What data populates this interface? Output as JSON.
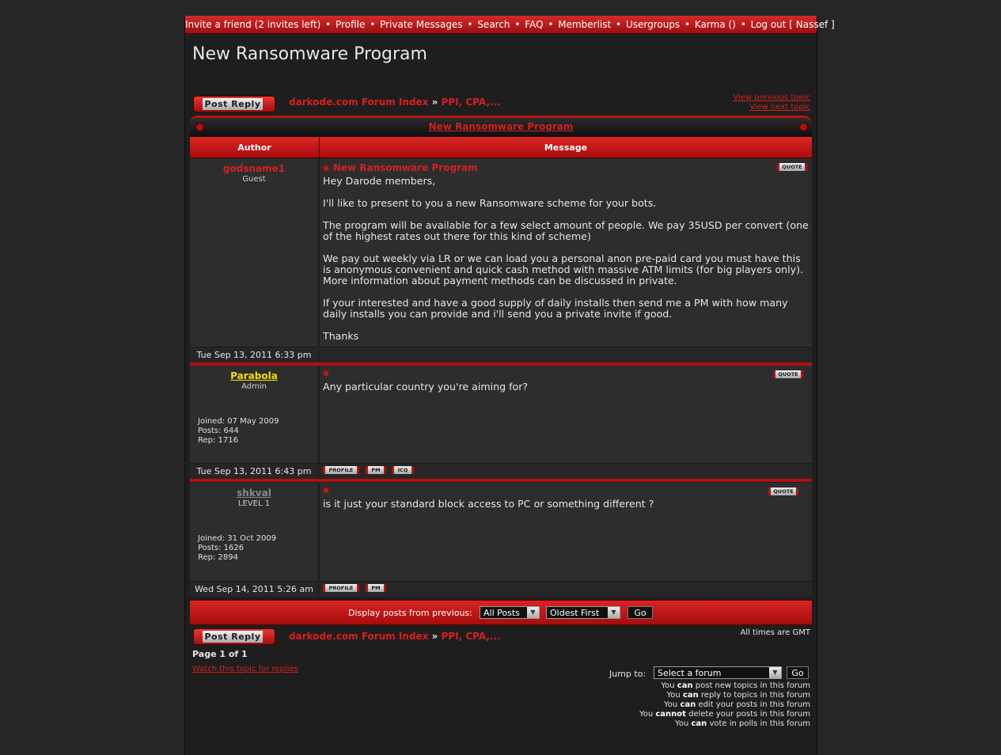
{
  "nav": {
    "items": [
      "Invite a friend (2 invites left)",
      "Profile",
      "Private Messages",
      "Search",
      "FAQ",
      "Memberlist",
      "Usergroups",
      "Karma ()",
      "Log out [ Nassef ]"
    ]
  },
  "page_title": "New Ransomware Program",
  "post_reply_label": "Post Reply",
  "breadcrumb": {
    "index": "darkode.com Forum Index",
    "arrow": "»",
    "forum": "PPI, CPA,..."
  },
  "prev_topic": "View previous topic",
  "next_topic": "View next topic",
  "topic_title": "New Ransomware Program",
  "columns": {
    "author": "Author",
    "message": "Message"
  },
  "quote_label": "QUOTE",
  "posts": [
    {
      "username": "godsname1",
      "rank": "Guest",
      "title": "New Ransomware Program",
      "body": [
        "Hey Darode members,",
        "I'll like to present to you a new Ransomware scheme for your bots.",
        "The program will be available for a few select amount of people. We pay 35USD per convert (one of the highest rates out there for this kind of scheme)",
        "We pay out weekly via LR or we can load you a personal anon pre-paid card you must have this is anonymous convenient and quick cash method with massive ATM limits (for big players only). More information about payment methods can be discussed in private.",
        "If your interested and have a good supply of daily installs then send me a PM with how many daily installs you can provide and i'll send you a private invite if good.",
        "Thanks"
      ],
      "date": "Tue Sep 13, 2011 6:33 pm"
    },
    {
      "username": "Parabola",
      "rank": "Admin",
      "joined": "Joined: 07 May 2009",
      "posts_count": "Posts: 644",
      "rep": "Rep: 1716",
      "body": [
        "Any particular country you're aiming for?"
      ],
      "date": "Tue Sep 13, 2011 6:43 pm",
      "buttons": [
        "PROFILE",
        "PM",
        "ICQ"
      ]
    },
    {
      "username": "shkval",
      "rank": "LEVEL 1",
      "joined": "Joined: 31 Oct 2009",
      "posts_count": "Posts: 1626",
      "rep": "Rep: 2894",
      "body": [
        "is it just your standard block access to PC or something different ?"
      ],
      "date": "Wed Sep 14, 2011 5:26 am",
      "buttons": [
        "PROFILE",
        "PM"
      ]
    }
  ],
  "display": {
    "label": "Display posts from previous:",
    "range_value": "All Posts",
    "order_value": "Oldest First",
    "go_label": "Go"
  },
  "footer": {
    "all_times": "All times are GMT",
    "page_of": "Page 1 of 1",
    "watch": "Watch this topic for replies",
    "jump_label": "Jump to:",
    "jump_value": "Select a forum",
    "go_label": "Go",
    "permissions": [
      [
        "You ",
        "can",
        " post new topics in this forum"
      ],
      [
        "You ",
        "can",
        " reply to topics in this forum"
      ],
      [
        "You ",
        "can",
        " edit your posts in this forum"
      ],
      [
        "You ",
        "cannot",
        " delete your posts in this forum"
      ],
      [
        "You ",
        "can",
        " vote in polls in this forum"
      ]
    ]
  },
  "colors": {
    "accent": "#d42020",
    "admin_name": "#f0e000",
    "guest_name": "#d42020",
    "level_name": "#888888"
  }
}
